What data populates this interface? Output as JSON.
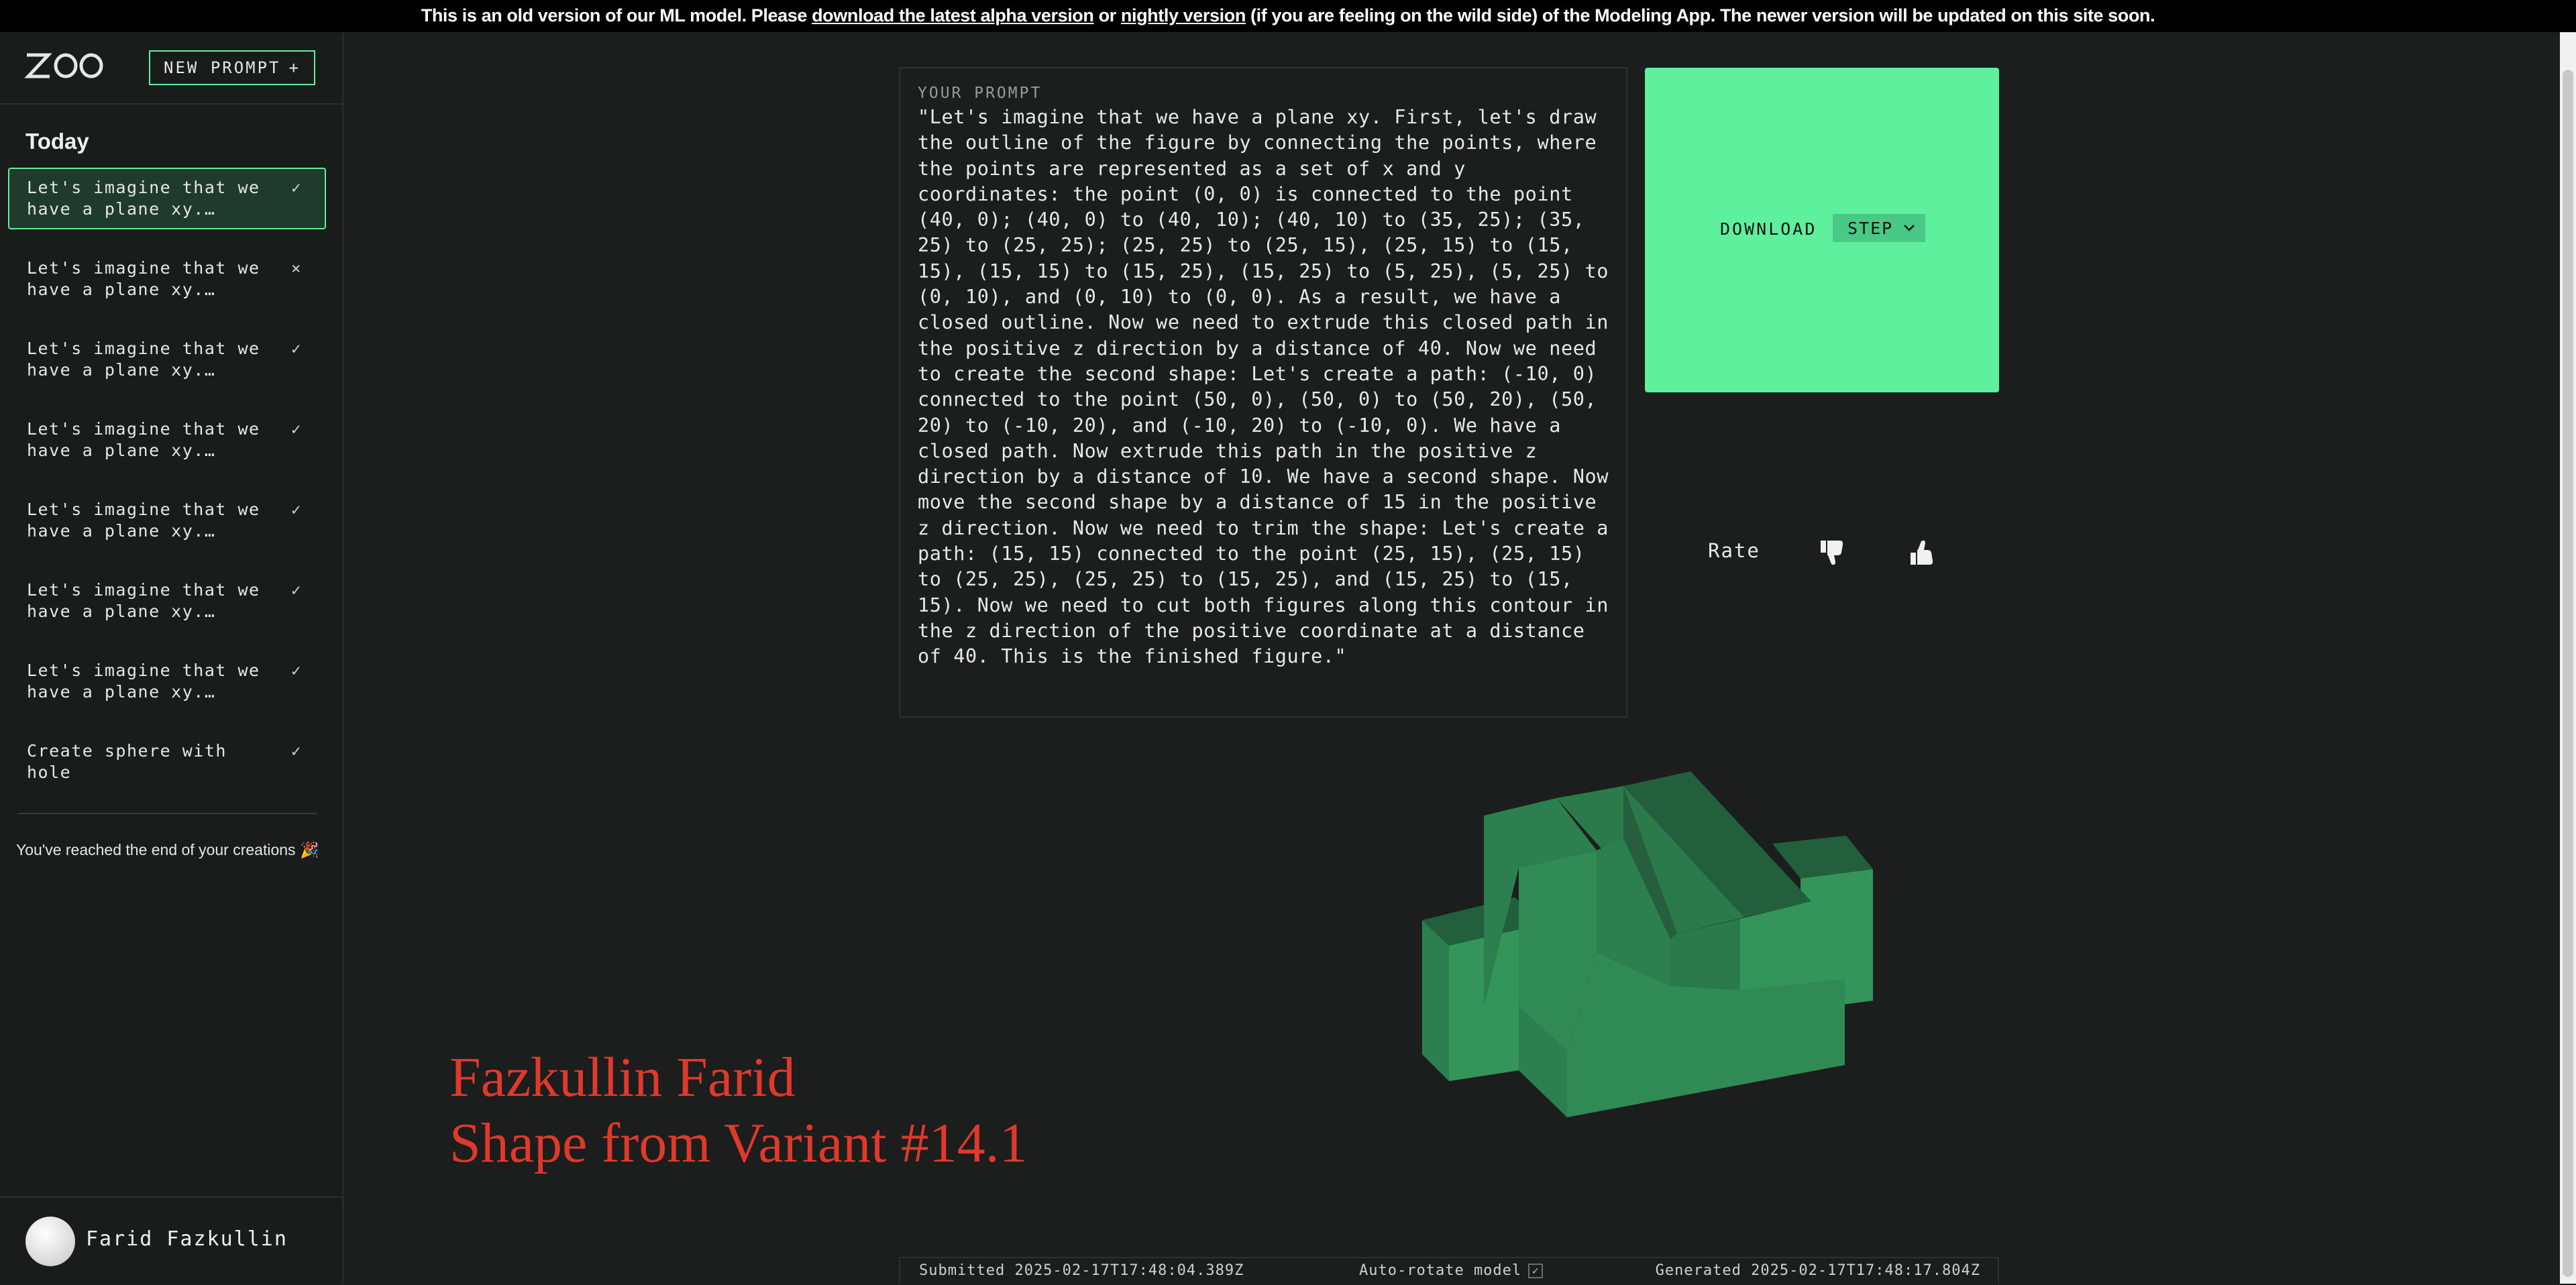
{
  "banner": {
    "prefix": "This is an old version of our ML model. Please ",
    "link_alpha": "download the latest alpha version",
    "mid": " or ",
    "link_nightly": "nightly version",
    "suffix": " (if you are feeling on the wild side) of the Modeling App. The newer version will be updated on this site soon."
  },
  "sidebar": {
    "logo": "ZOO",
    "new_prompt_label": "NEW PROMPT",
    "new_prompt_icon": "+",
    "section_title": "Today",
    "items": [
      {
        "label": "Let's imagine that we have a plane xy.…",
        "status": "✓"
      },
      {
        "label": "Let's imagine that we have a plane xy.…",
        "status": "×"
      },
      {
        "label": "Let's imagine that we have a plane xy.…",
        "status": "✓"
      },
      {
        "label": "Let's imagine that we have a plane xy.…",
        "status": "✓"
      },
      {
        "label": "Let's imagine that we have a plane xy.…",
        "status": "✓"
      },
      {
        "label": "Let's imagine that we have a plane xy.…",
        "status": "✓"
      },
      {
        "label": "Let's imagine that we have a plane xy.…",
        "status": "✓"
      },
      {
        "label": "Create sphere with hole",
        "status": "✓"
      }
    ],
    "end_note": "You've reached the end of your creations 🎉",
    "user_name": "Farid Fazkullin"
  },
  "prompt": {
    "label": "YOUR PROMPT",
    "text": "\"Let's imagine that we have a plane xy. First, let's draw the outline of the figure by connecting the points, where the points are represented as a set of x and y coordinates: the point (0, 0) is connected to the point (40, 0); (40, 0) to (40, 10); (40, 10) to (35, 25); (35, 25) to (25, 25); (25, 25) to (25, 15), (25, 15) to (15, 15), (15, 15) to (15, 25), (15, 25) to (5, 25), (5, 25) to (0, 10), and (0, 10) to (0, 0). As a result, we have a closed outline. Now we need to extrude this closed path in the positive z direction by a distance of 40. Now we need to create the second shape: Let's create a path: (-10, 0) connected to the point (50, 0), (50, 0) to (50, 20), (50, 20) to (-10, 20), and (-10, 20) to (-10, 0). We have a closed path. Now extrude this path in the positive z direction by a distance of 10. We have a second shape. Now move the second shape by a distance of 15 in the positive z direction. Now we need to trim the shape: Let's create a path: (15, 15) connected to the point (25, 15), (25, 15) to (25, 25), (25, 25) to (15, 25), and (15, 25) to (15, 15). Now we need to cut both figures along this contour in the z direction of the positive coordinate at a distance of 40. This is the finished figure.\""
  },
  "download": {
    "label": "DOWNLOAD",
    "format": "STEP",
    "accent": "#5ef09d"
  },
  "rating": {
    "label": "Rate",
    "down_icon": "thumbs-down-icon",
    "up_icon": "thumbs-up-icon"
  },
  "overlay": {
    "line1": "Fazkullin Farid",
    "line2": "Shape from Variant #14.1",
    "color": "#e0382b"
  },
  "footer": {
    "submitted": "Submitted 2025-02-17T17:48:04.389Z",
    "auto_rotate": "Auto-rotate model",
    "auto_rotate_checked": "✓",
    "generated": "Generated 2025-02-17T17:48:17.804Z"
  }
}
